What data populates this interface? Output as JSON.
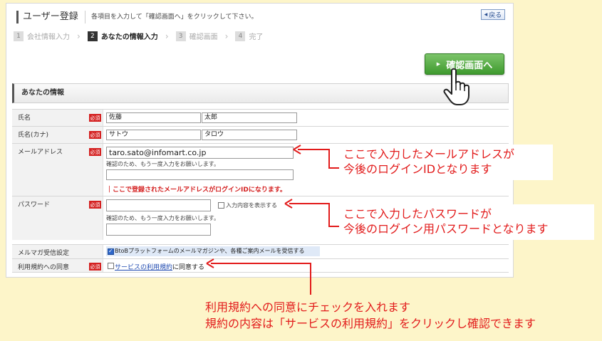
{
  "header": {
    "title": "ユーザー登録",
    "description": "各項目を入力して「確認画面へ」をクリックして下さい。",
    "back_label": "戻る"
  },
  "steps": [
    {
      "num": "1",
      "label": "会社情報入力",
      "active": false
    },
    {
      "num": "2",
      "label": "あなたの情報入力",
      "active": true
    },
    {
      "num": "3",
      "label": "確認画面",
      "active": false
    },
    {
      "num": "4",
      "label": "完了",
      "active": false
    }
  ],
  "confirm_button_label": "確認画面へ",
  "section_title": "あなたの情報",
  "required_badge": "必須",
  "form": {
    "name": {
      "label": "氏名",
      "last": "佐藤",
      "first": "太郎"
    },
    "kana": {
      "label": "氏名(カナ)",
      "last": "サトウ",
      "first": "タロウ"
    },
    "email": {
      "label": "メールアドレス",
      "value": "taro.sato@infomart.co.jp",
      "confirm_note": "確認のため、もう一度入力をお願いします。",
      "confirm_value": "",
      "warning": "｜ここで登録されたメールアドレスがログインIDになります。"
    },
    "password": {
      "label": "パスワード",
      "value": "",
      "show_label": "入力内容を表示する",
      "confirm_note": "確認のため、もう一度入力をお願いします。",
      "confirm_value": ""
    },
    "mailmag": {
      "label": "メルマガ受信設定",
      "text": "BtoBプラットフォームのメールマガジンや、各種ご案内メールを受信する",
      "checked": true
    },
    "agree": {
      "label": "利用規約への同意",
      "link": "サービスの利用規約",
      "suffix": "に同意する",
      "checked": false
    }
  },
  "annotations": {
    "email_line1": "ここで入力したメールアドレスが",
    "email_line2": "今後のログインIDとなります",
    "password_line1": "ここで入力したパスワードが",
    "password_line2": "今後のログイン用パスワードとなります",
    "agree_line1": "利用規約への同意にチェックを入れます",
    "agree_line2": "規約の内容は「サービスの利用規約」をクリックし確認できます"
  },
  "colors": {
    "accent_green": "#3e9a2e",
    "required_red": "#d42020",
    "annotation_red": "#e21b1b",
    "background_yellow": "#fdf5c9"
  }
}
